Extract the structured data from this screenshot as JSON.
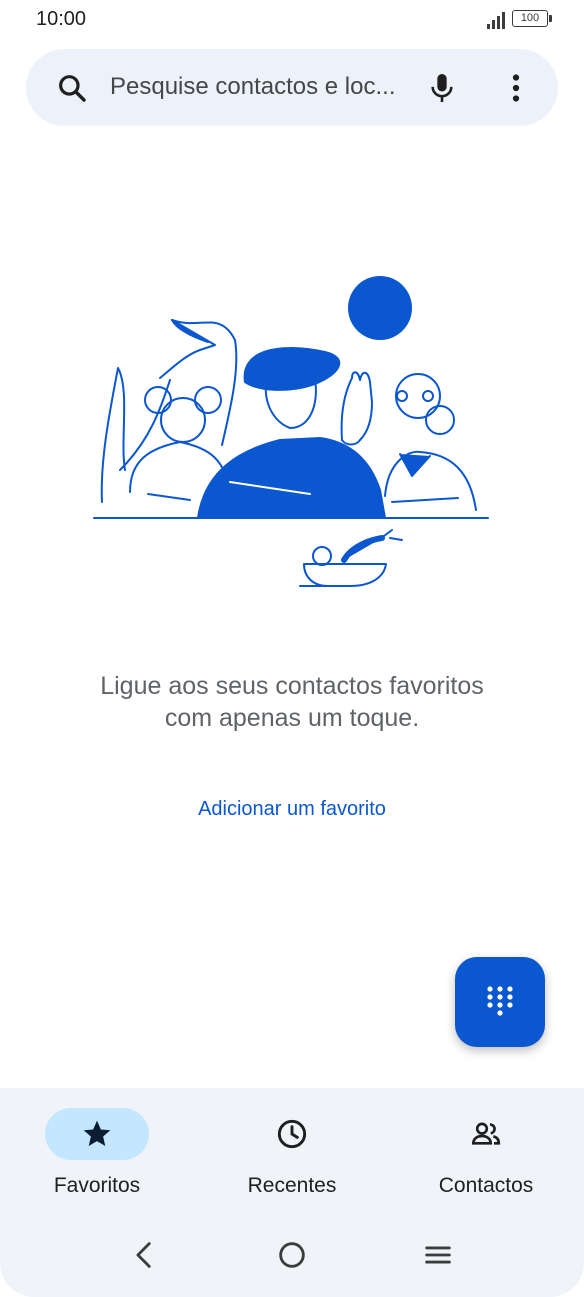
{
  "status_bar": {
    "time": "10:00",
    "battery": "100"
  },
  "search": {
    "placeholder": "Pesquise contactos e loc..."
  },
  "empty_state": {
    "message": "Ligue aos seus contactos favoritos com apenas um toque.",
    "action": "Adicionar um favorito"
  },
  "bottom_nav": {
    "items": [
      {
        "label": "Favoritos",
        "icon": "star-icon",
        "active": true
      },
      {
        "label": "Recentes",
        "icon": "clock-icon",
        "active": false
      },
      {
        "label": "Contactos",
        "icon": "people-icon",
        "active": false
      }
    ]
  },
  "colors": {
    "accent": "#0b57d0",
    "search_bg": "#edf2fa",
    "nav_bg": "#f0f4f9",
    "active_pill": "#c2e7ff"
  }
}
